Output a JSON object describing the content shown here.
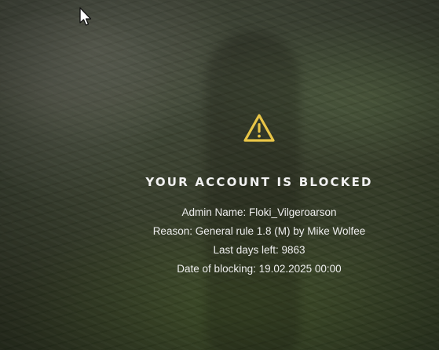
{
  "block_screen": {
    "icon": "warning-triangle-icon",
    "accent_color": "#e8c547",
    "title": "YOUR ACCOUNT IS BLOCKED",
    "admin_name_line": "Admin Name: Floki_Vilgeroarson",
    "reason_line": "Reason: General rule 1.8 (M) by Mike Wolfee",
    "days_left_line": "Last days left: 9863",
    "date_line": "Date of blocking: 19.02.2025 00:00"
  },
  "pointer": {
    "icon": "mouse-cursor-icon"
  }
}
